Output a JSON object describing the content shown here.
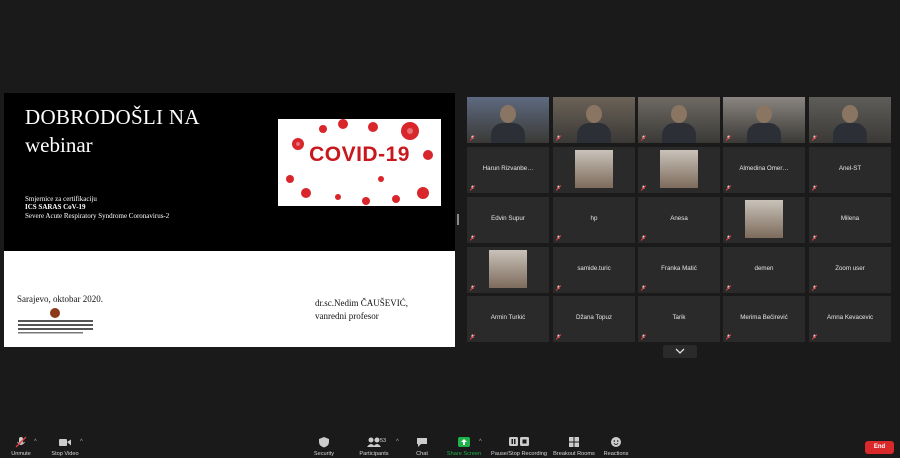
{
  "slide": {
    "title_line1": "DOBRODOŠLI NA",
    "title_line2": "webinar",
    "subtitle1": "Smjernice za certifikaciju",
    "subtitle2": "ICS SARAS CoV-19",
    "subtitle3": "Severe Acute Respiratory Syndrome Coronavirus-2",
    "covid_label": "COVID-19",
    "city_date": "Sarajevo, oktobar 2020.",
    "author_line1": "dr.sc.Nedim ČAUŠEVIĆ,",
    "author_line2": "vanredni profesor"
  },
  "participants": [
    {
      "name": "",
      "kind": "video",
      "active": true
    },
    {
      "name": "",
      "kind": "video"
    },
    {
      "name": "",
      "kind": "video"
    },
    {
      "name": "",
      "kind": "video"
    },
    {
      "name": "",
      "kind": "video"
    },
    {
      "name": "Harun Rizvanbe…",
      "kind": "name"
    },
    {
      "name": "",
      "kind": "photo"
    },
    {
      "name": "",
      "kind": "photo"
    },
    {
      "name": "Almedina Omer…",
      "kind": "name"
    },
    {
      "name": "Anel-ST",
      "kind": "name"
    },
    {
      "name": "Edvin Supur",
      "kind": "name"
    },
    {
      "name": "hp",
      "kind": "name"
    },
    {
      "name": "Anesa",
      "kind": "name"
    },
    {
      "name": "",
      "kind": "photo"
    },
    {
      "name": "Milena",
      "kind": "name"
    },
    {
      "name": "",
      "kind": "photo"
    },
    {
      "name": "samide.turic",
      "kind": "name"
    },
    {
      "name": "Franka Matić",
      "kind": "name"
    },
    {
      "name": "demen",
      "kind": "name"
    },
    {
      "name": "Zoom user",
      "kind": "name"
    },
    {
      "name": "Armin Turkić",
      "kind": "name"
    },
    {
      "name": "Džana Topuz",
      "kind": "name"
    },
    {
      "name": "Tarik",
      "kind": "name"
    },
    {
      "name": "Merima Bečirević",
      "kind": "name"
    },
    {
      "name": "Amna Kevacevic",
      "kind": "name"
    }
  ],
  "toolbar": {
    "unmute": "Unmute",
    "stop_video": "Stop Video",
    "security": "Security",
    "participants": "Participants",
    "participants_count": "53",
    "chat": "Chat",
    "share_screen": "Share Screen",
    "pause_recording": "Pause/Stop Recording",
    "breakout_rooms": "Breakout Rooms",
    "reactions": "Reactions",
    "end": "End"
  },
  "icons": {
    "mic": "microphone-muted-icon",
    "video": "video-camera-icon",
    "security": "shield-icon",
    "participants": "people-icon",
    "chat": "chat-bubble-icon",
    "share": "share-screen-icon",
    "record": "pause-stop-icon",
    "breakout": "grid-icon",
    "reactions": "smiley-icon",
    "next": "chevron-down-icon"
  },
  "colors": {
    "background": "#1a1a1a",
    "active_speaker": "#b7d84b",
    "share_green": "#20b24b",
    "end_red": "#d9292b",
    "mute_red": "#e23c3c",
    "covid_red": "#c8181e"
  }
}
